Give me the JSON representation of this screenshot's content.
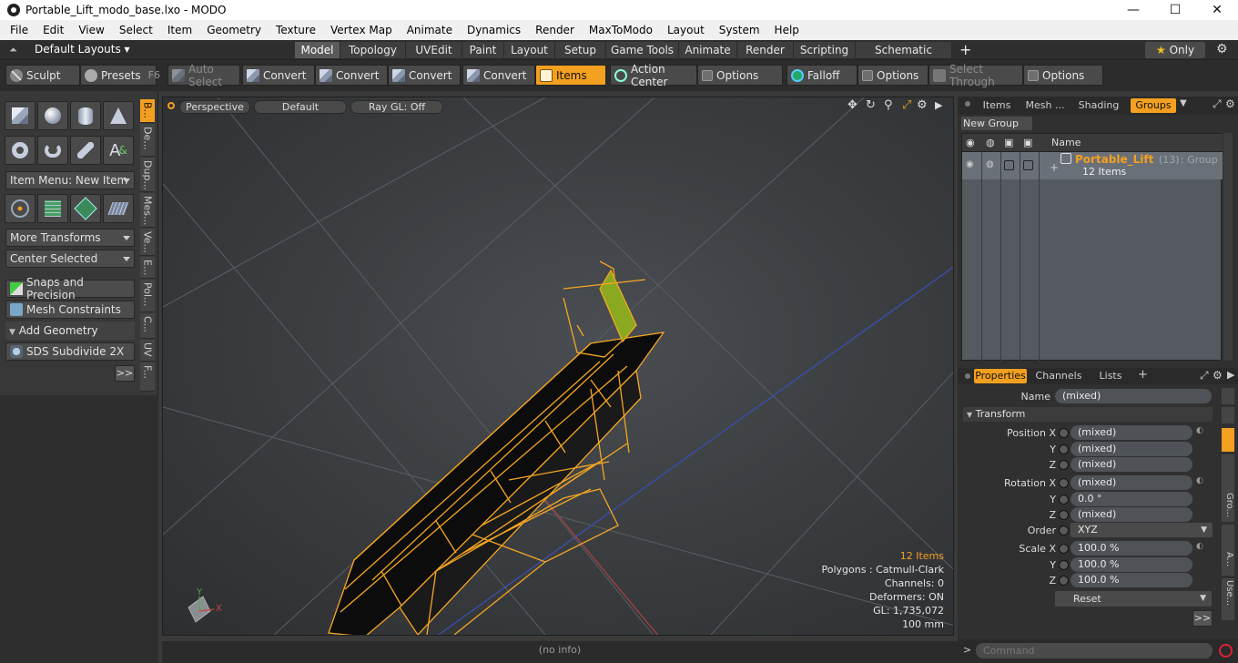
{
  "window": {
    "title": "Portable_Lift_modo_base.lxo - MODO",
    "minimize": "—",
    "maximize": "☐",
    "close": "✕"
  },
  "menu": [
    "File",
    "Edit",
    "View",
    "Select",
    "Item",
    "Geometry",
    "Texture",
    "Vertex Map",
    "Animate",
    "Dynamics",
    "Render",
    "MaxToModo",
    "Layout",
    "System",
    "Help"
  ],
  "layouts": {
    "selector": "Default Layouts",
    "tabs": [
      "Model",
      "Topology",
      "UVEdit",
      "Paint",
      "Layout",
      "Setup",
      "Game Tools",
      "Animate",
      "Render",
      "Scripting",
      "Schematic Fusion"
    ],
    "active": "Model",
    "add": "+",
    "only_label": "Only",
    "only_star": "★"
  },
  "toolbar": {
    "sculpt": "Sculpt",
    "presets": "Presets",
    "presets_key": "F6",
    "auto_select": "Auto Select",
    "convert1": "Convert",
    "convert2": "Convert",
    "convert3": "Convert",
    "convert4": "Convert",
    "items": "Items",
    "action_center": "Action Center",
    "options1": "Options",
    "falloff": "Falloff",
    "options2": "Options",
    "select_through": "Select Through",
    "options3": "Options"
  },
  "leftpanel": {
    "item_menu": "Item Menu: New Item",
    "more_transforms": "More Transforms",
    "center_selected": "Center Selected",
    "snaps": "Snaps and Precision",
    "mesh_constraints": "Mesh Constraints",
    "add_geometry": "Add Geometry",
    "sds": "SDS Subdivide 2X",
    "more": ">>",
    "vtabs": [
      "B...",
      "De...",
      "Dup...",
      "Mes...",
      "Ve...",
      "E...",
      "Pol...",
      "C...",
      "UV",
      "F..."
    ]
  },
  "viewport": {
    "view": "Perspective",
    "shading": "Default",
    "raygl": "Ray GL: Off",
    "stats": {
      "items": "12 Items",
      "polygons": "Polygons : Catmull-Clark",
      "channels": "Channels: 0",
      "deformers": "Deformers: ON",
      "gl": "GL: 1,735,072",
      "unit": "100 mm"
    },
    "axis_x": "X",
    "axis_y": "Y",
    "accent": "#f5a623"
  },
  "status": {
    "info": "(no info)",
    "command_placeholder": "Command"
  },
  "groups": {
    "tabs": [
      "Items",
      "Mesh ...",
      "Shading",
      "Groups"
    ],
    "active": "Groups",
    "new_group": "New Group",
    "header_name": "Name",
    "row_name": "Portable_Lift",
    "row_count": "(13)",
    "row_type": ": Group",
    "row_items": "12 Items",
    "expand": "+"
  },
  "properties": {
    "tabs": [
      "Properties",
      "Channels",
      "Lists"
    ],
    "active": "Properties",
    "add": "+",
    "name_label": "Name",
    "name_value": "(mixed)",
    "transform": "Transform",
    "position_label": "Position X",
    "rotation_label": "Rotation X",
    "scale_label": "Scale X",
    "y": "Y",
    "z": "Z",
    "position": [
      "(mixed)",
      "(mixed)",
      "(mixed)"
    ],
    "rotation": [
      "(mixed)",
      "0.0 °",
      "(mixed)"
    ],
    "order_label": "Order",
    "order_value": "XYZ",
    "scale": [
      "100.0 %",
      "100.0 %",
      "100.0 %"
    ],
    "reset": "Reset",
    "more": ">>",
    "side_tabs": [
      "Gro...",
      "A...",
      "Use..."
    ]
  }
}
